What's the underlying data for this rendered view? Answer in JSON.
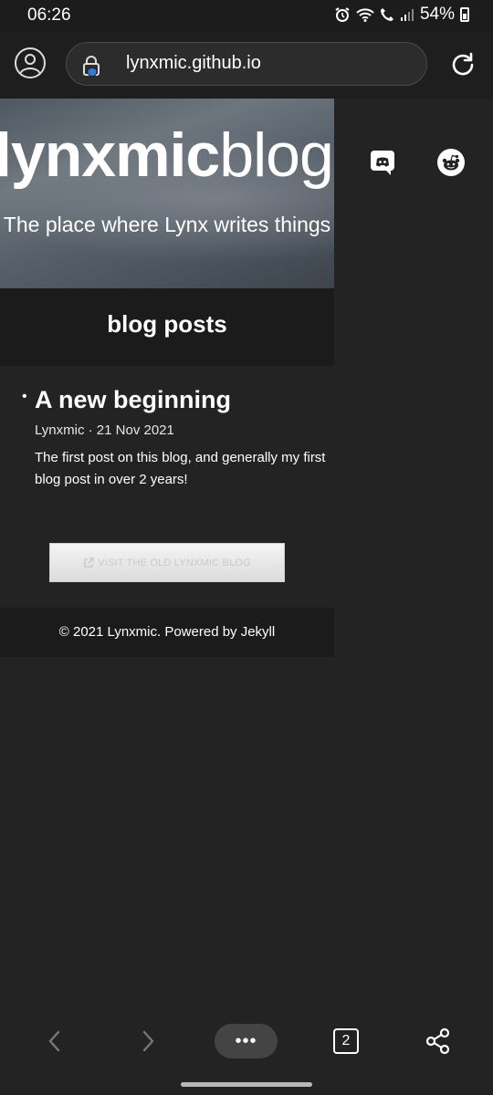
{
  "status_bar": {
    "time": "06:26",
    "battery": "54%",
    "icons": [
      "alarm-icon",
      "wifi-icon",
      "call-icon",
      "signal-icon",
      "battery-icon"
    ]
  },
  "browser": {
    "url": "lynxmic.github.io",
    "open_tabs": "2",
    "menu_label": "•••"
  },
  "site": {
    "title_bold": "lynxmic",
    "title_light": "blog",
    "subtitle": "The place where Lynx writes things",
    "social": [
      "discord-icon",
      "reddit-icon"
    ],
    "section_title": "blog posts",
    "posts": [
      {
        "title": "A new beginning",
        "meta": "Lynxmic · 21 Nov 2021",
        "excerpt": "The first post on this blog, and generally my first blog post in over 2 years!"
      }
    ],
    "old_blog_button": "VISIT THE OLD LYNXMIC BLOG",
    "footer": "© 2021 Lynxmic. Powered by Jekyll"
  },
  "colors": {
    "page_bg": "#232323",
    "section_bg": "#1b1b1b",
    "text": "#ffffff"
  }
}
